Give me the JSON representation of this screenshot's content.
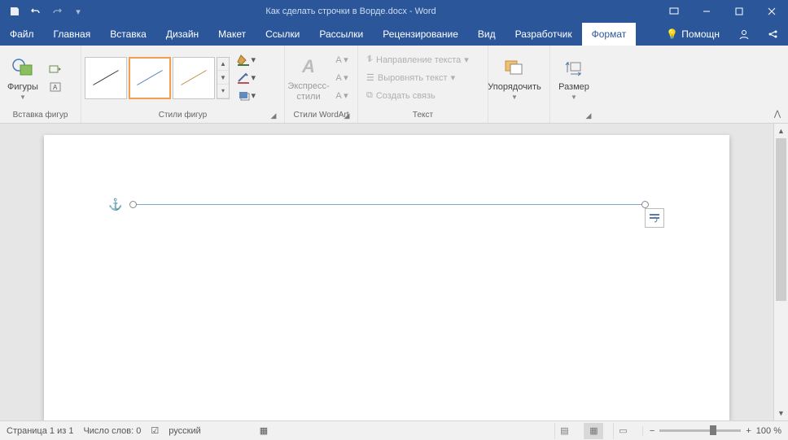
{
  "title": "Как сделать строчки в Ворде.docx - Word",
  "tabs": [
    "Файл",
    "Главная",
    "Вставка",
    "Дизайн",
    "Макет",
    "Ссылки",
    "Рассылки",
    "Рецензирование",
    "Вид",
    "Разработчик"
  ],
  "active_tab": "Формат",
  "help_label": "Помощн",
  "groups": {
    "shapes": {
      "label": "Вставка фигур",
      "btn": "Фигуры"
    },
    "styles": {
      "label": "Стили фигур"
    },
    "express": {
      "btn": "Экспресс-\nстили",
      "label": "Стили WordArt"
    },
    "text": {
      "label": "Текст",
      "items": [
        "Направление текста",
        "Выровнять текст",
        "Создать связь"
      ]
    },
    "arrange": {
      "btn": "Упорядочить"
    },
    "size": {
      "btn": "Размер"
    }
  },
  "style_colors": [
    "#333333",
    "#4a7abc",
    "#c08a3e"
  ],
  "status": {
    "page": "Страница 1 из 1",
    "words": "Число слов: 0",
    "lang": "русский",
    "zoom": "100 %"
  }
}
